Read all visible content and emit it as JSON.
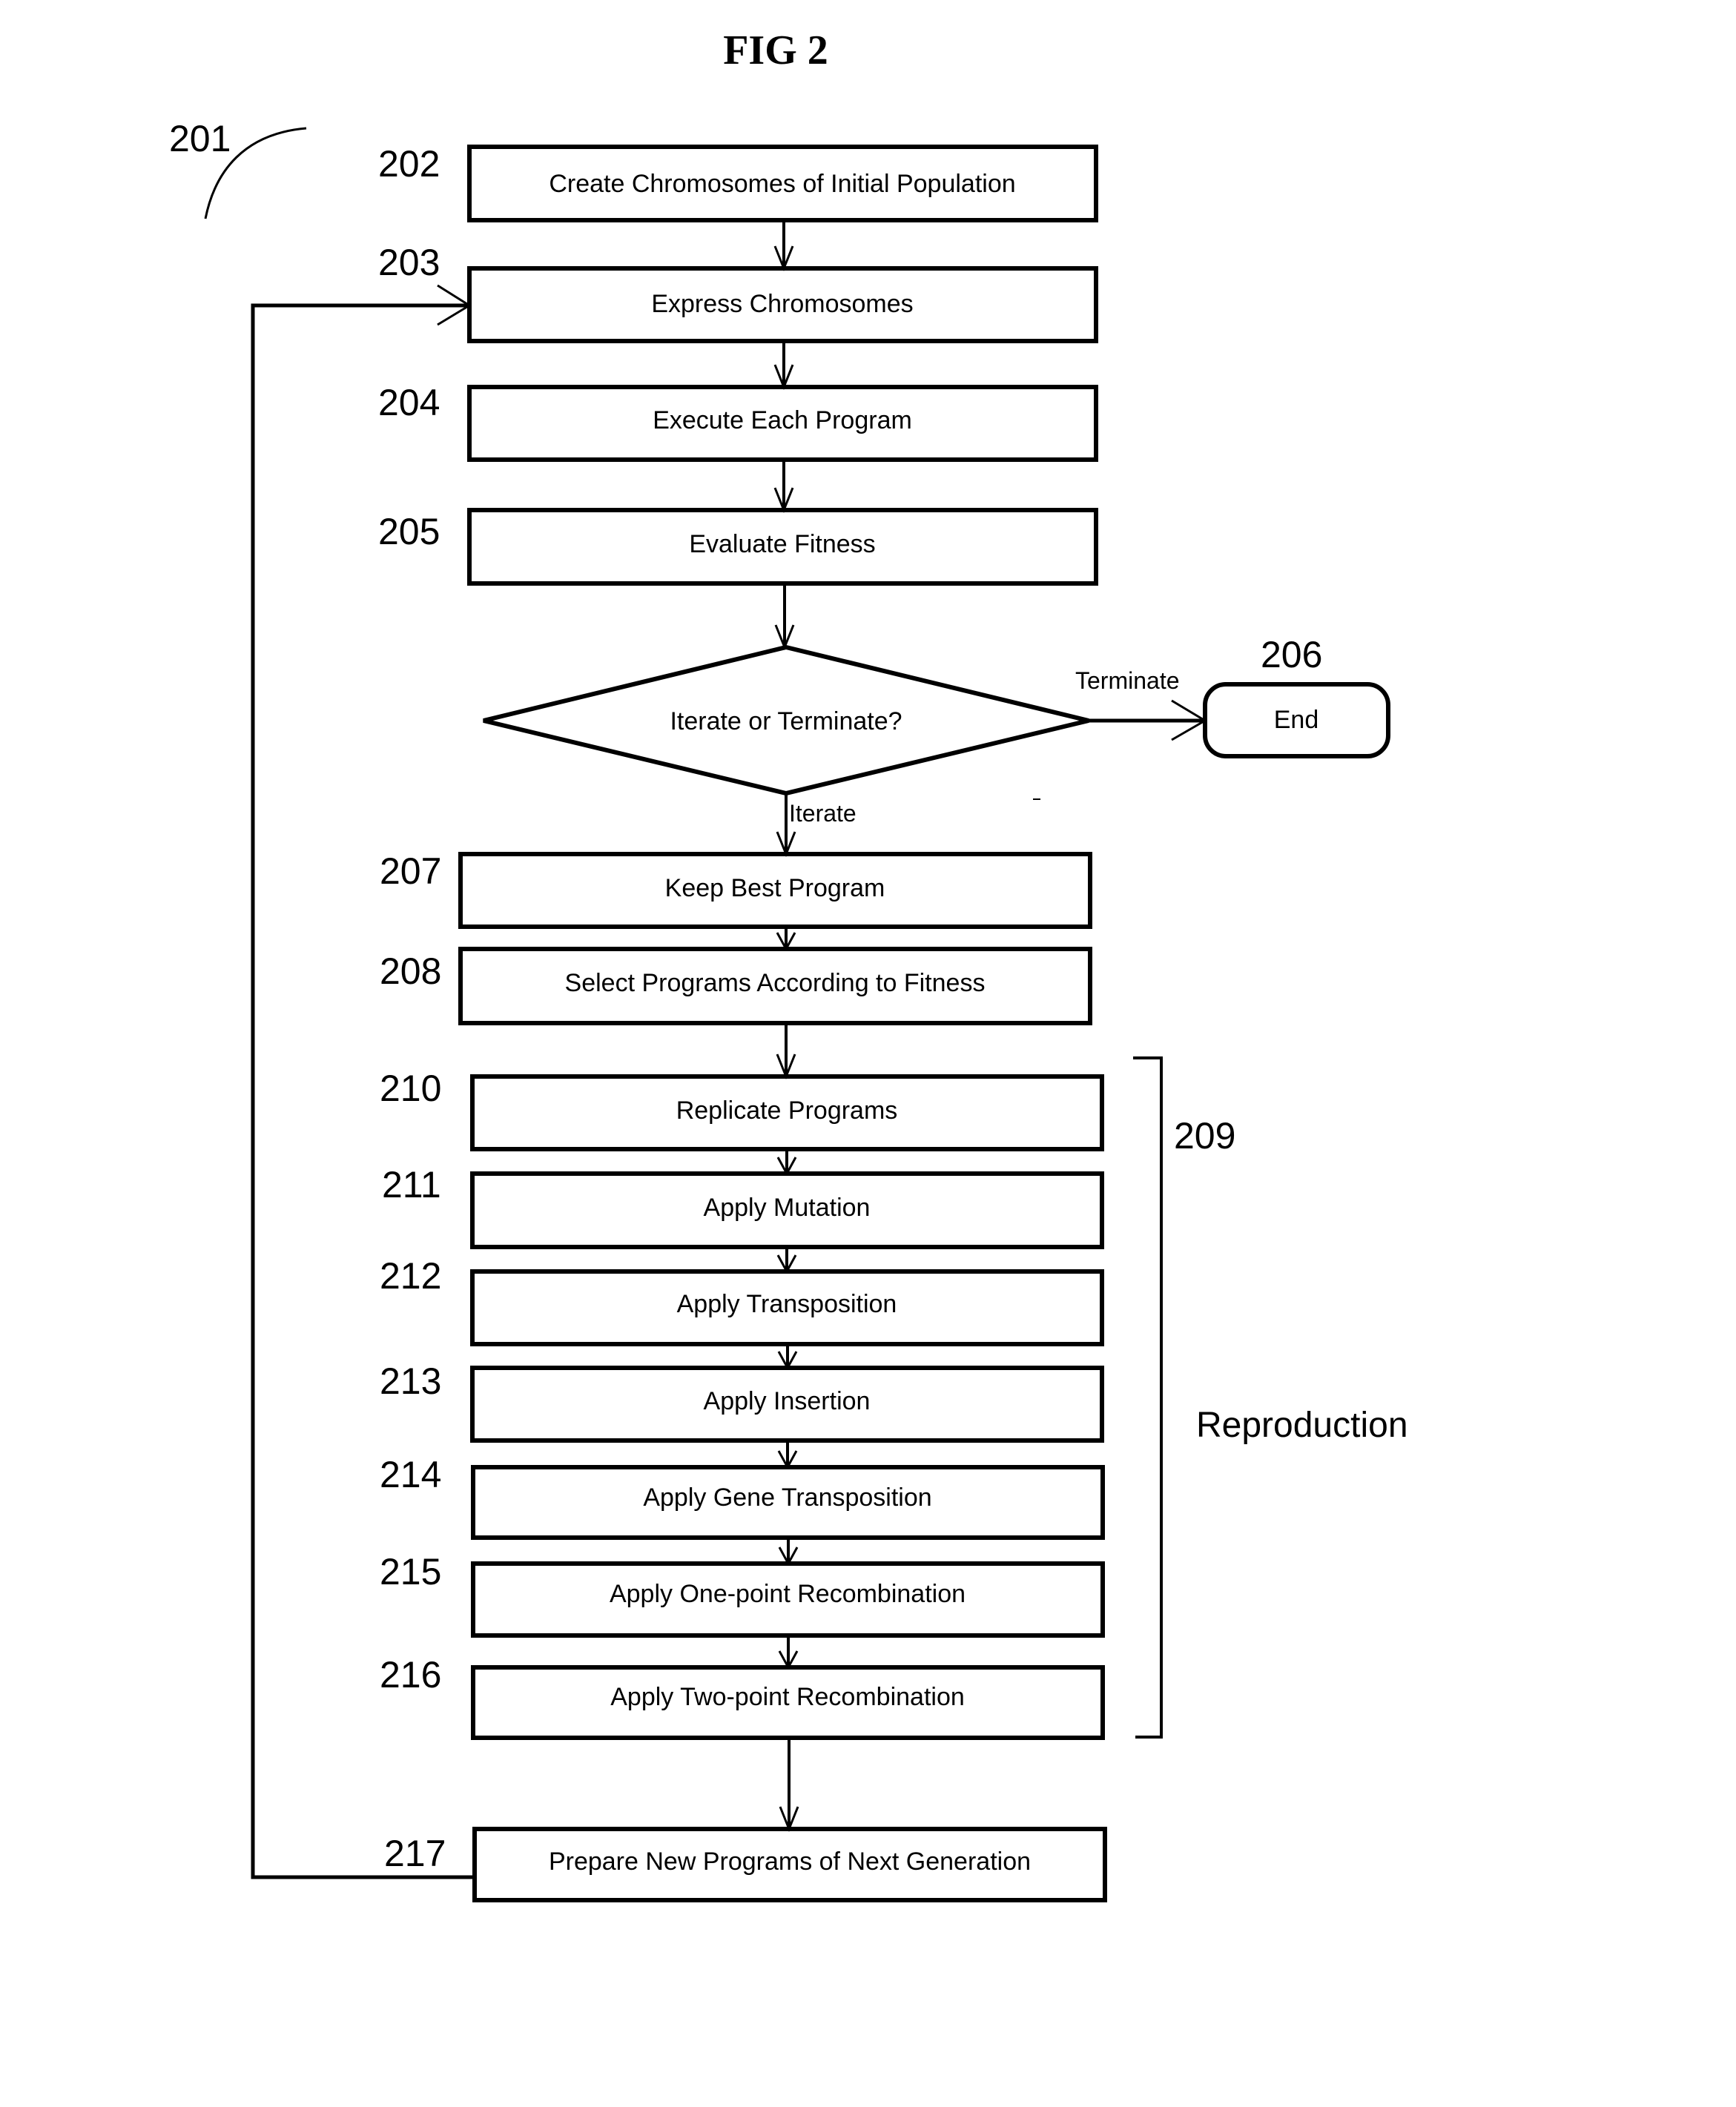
{
  "title": "FIG 2",
  "figure_ref": "201",
  "steps": [
    {
      "id": "202",
      "label": "Create Chromosomes of Initial Population"
    },
    {
      "id": "203",
      "label": "Express Chromosomes"
    },
    {
      "id": "204",
      "label": "Execute Each Program"
    },
    {
      "id": "205",
      "label": "Evaluate Fitness"
    },
    {
      "id": "207",
      "label": "Keep Best Program"
    },
    {
      "id": "208",
      "label": "Select Programs According to Fitness"
    },
    {
      "id": "210",
      "label": "Replicate Programs"
    },
    {
      "id": "211",
      "label": "Apply Mutation"
    },
    {
      "id": "212",
      "label": "Apply Transposition"
    },
    {
      "id": "213",
      "label": "Apply Insertion"
    },
    {
      "id": "214",
      "label": "Apply Gene Transposition"
    },
    {
      "id": "215",
      "label": "Apply One-point Recombination"
    },
    {
      "id": "216",
      "label": "Apply Two-point Recombination"
    },
    {
      "id": "217",
      "label": "Prepare New Programs of Next Generation"
    }
  ],
  "decision": {
    "label": "Iterate or Terminate?",
    "yes_label": "Terminate",
    "no_label": "Iterate"
  },
  "end": {
    "id": "206",
    "label": "End"
  },
  "group": {
    "id": "209",
    "label": "Reproduction"
  }
}
